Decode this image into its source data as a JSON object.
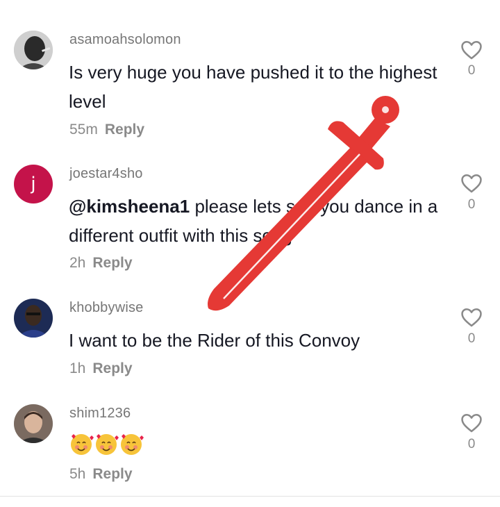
{
  "comments": [
    {
      "username": "asamoahsolomon",
      "text": "Is very huge you have pushed it to the highest level",
      "time": "55m",
      "reply_label": "Reply",
      "likes": "0"
    },
    {
      "username": "joestar4sho",
      "avatar_letter": "j",
      "mention": "@kimsheena1",
      "text": " please lets see you dance in a different outfit with this song",
      "time": "2h",
      "reply_label": "Reply",
      "likes": "0"
    },
    {
      "username": "khobbywise",
      "text": "I want to be the Rider of this Convoy",
      "time": "1h",
      "reply_label": "Reply",
      "likes": "0"
    },
    {
      "username": "shim1236",
      "text": "🥰🥰🥰",
      "time": "5h",
      "reply_label": "Reply",
      "likes": "0"
    }
  ],
  "colors": {
    "text": "#161823",
    "muted": "#8a8a8a",
    "avatar_j": "#c4134a",
    "sword": "#e53935"
  }
}
